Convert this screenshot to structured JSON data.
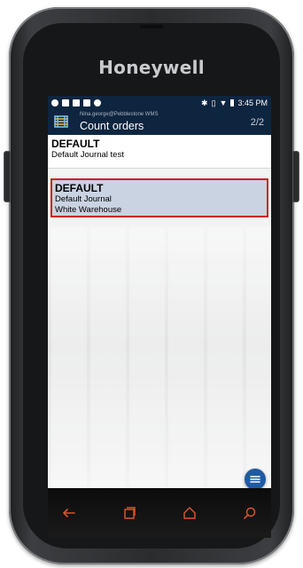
{
  "device": {
    "brand": "Honeywell"
  },
  "status_bar": {
    "time": "3:45 PM"
  },
  "header": {
    "user": "Nina.george@Pebblestone WMS",
    "title": "Count orders",
    "page_count": "2/2"
  },
  "list": {
    "items": [
      {
        "title": "DEFAULT",
        "lines": [
          "Default Journal test"
        ],
        "selected": false
      },
      {
        "title": "DEFAULT",
        "lines": [
          "Default Journal",
          "White Warehouse"
        ],
        "selected": true
      }
    ]
  },
  "colors": {
    "header_bg": "#0e2540",
    "selected_bg": "#c9d3e1",
    "selected_border": "#d0151c",
    "fab_bg": "#1f5aa5",
    "nav_icon": "#d9532b"
  },
  "icons": {
    "app_logo": "pebblestone-logo-icon",
    "fab": "menu-icon",
    "nav_back": "back-arrow-icon",
    "nav_recent": "recent-apps-icon",
    "nav_home": "home-icon",
    "nav_search": "search-icon"
  }
}
